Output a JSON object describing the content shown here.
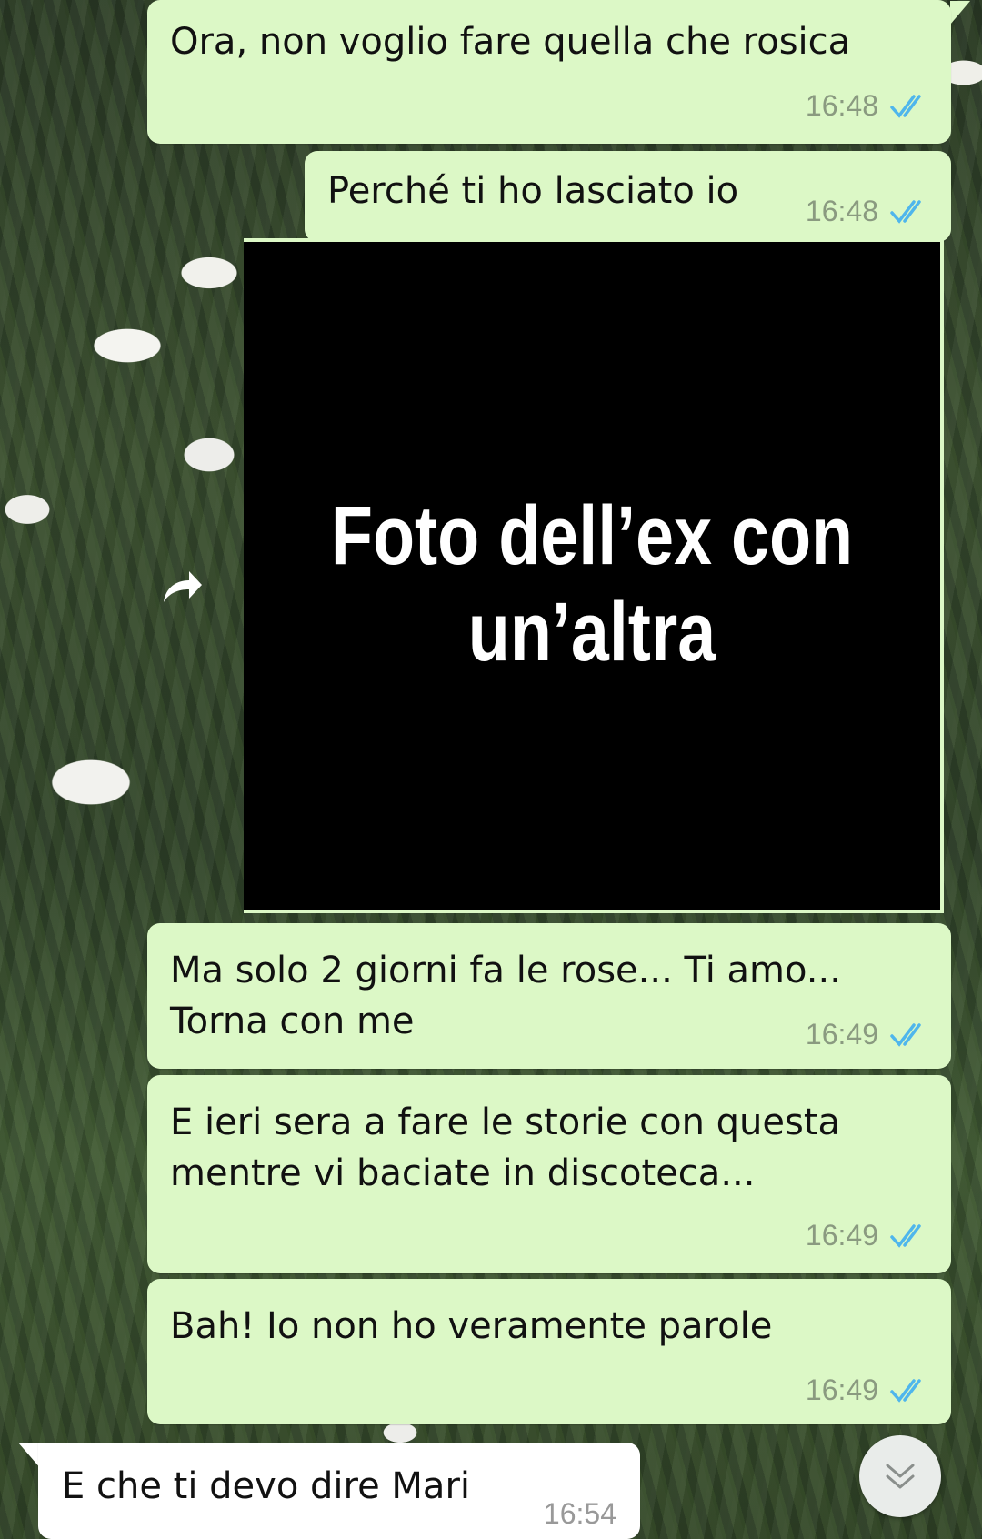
{
  "messages": [
    {
      "text": "Ora, non voglio fare quella che rosica",
      "time": "16:48",
      "status": "read"
    },
    {
      "text": "Perché ti ho lasciato io",
      "time": "16:48",
      "status": "read"
    },
    {
      "image_caption": "Foto dell’ex con un’altra"
    },
    {
      "text": "Ma solo 2 giorni fa le rose... Ti amo...\nTorna con me",
      "time": "16:49",
      "status": "read"
    },
    {
      "text": "E ieri sera a fare le storie con questa\nmentre vi baciate in discoteca...",
      "time": "16:49",
      "status": "read"
    },
    {
      "text": "Bah! Io non ho veramente parole",
      "time": "16:49",
      "status": "read"
    },
    {
      "text": "E che ti devo dire Mari",
      "time": "16:54",
      "status": "incoming"
    }
  ],
  "colors": {
    "outgoing_bubble": "#dcf8c6",
    "incoming_bubble": "#ffffff",
    "read_ticks": "#4fb6ec"
  },
  "icons": {
    "read_receipt": "double-check-icon",
    "forward": "forward-arrow-icon",
    "scroll_down": "double-chevron-down-icon"
  }
}
